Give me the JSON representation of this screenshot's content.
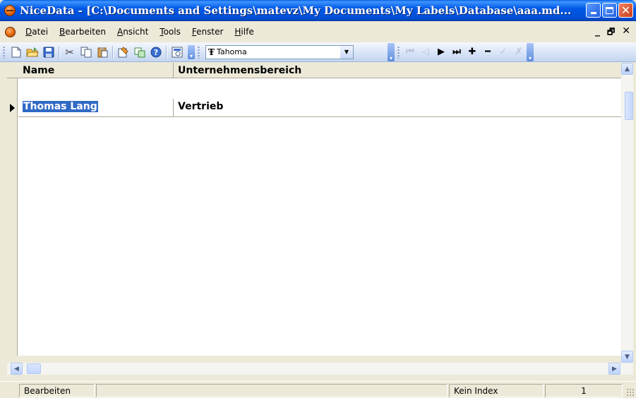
{
  "window": {
    "title": "NiceData - [C:\\Documents and Settings\\matevz\\My Documents\\My Labels\\Database\\aaa.md...",
    "minimize_label": "minimize",
    "maximize_label": "maximize",
    "close_label": "close"
  },
  "menu": {
    "items": [
      {
        "label": "Datei",
        "accel": "D"
      },
      {
        "label": "Bearbeiten",
        "accel": "B"
      },
      {
        "label": "Ansicht",
        "accel": "A"
      },
      {
        "label": "Tools",
        "accel": "T"
      },
      {
        "label": "Fenster",
        "accel": "F"
      },
      {
        "label": "Hilfe",
        "accel": "H"
      }
    ],
    "mdi_minimize": "_",
    "mdi_restore": "🗗",
    "mdi_close": "✕"
  },
  "toolbar": {
    "font_name": "Tahoma",
    "font_prefix": "Ŧ",
    "icons": [
      "new-icon",
      "open-folder-icon",
      "save-icon",
      "cut-icon",
      "copy-icon",
      "paste-icon",
      "wizard-icon",
      "database-icon",
      "help-icon",
      "preview-icon"
    ]
  },
  "navigator": {
    "first": "⏮",
    "prev": "◁",
    "next": "▶",
    "last": "⏭",
    "insert": "✚",
    "delete": "━",
    "post": "✓",
    "cancel": "✗"
  },
  "grid": {
    "columns": [
      "Name",
      "Unternehmensbereich"
    ],
    "rows": [
      {
        "name": "Thomas Lang",
        "department": "Vertrieb"
      }
    ]
  },
  "status": {
    "mode": "Bearbeiten",
    "index": "Kein Index",
    "record": "1"
  },
  "colors": {
    "titlebar": "#0058e6",
    "selection": "#316ac5",
    "face": "#ece9d8"
  }
}
